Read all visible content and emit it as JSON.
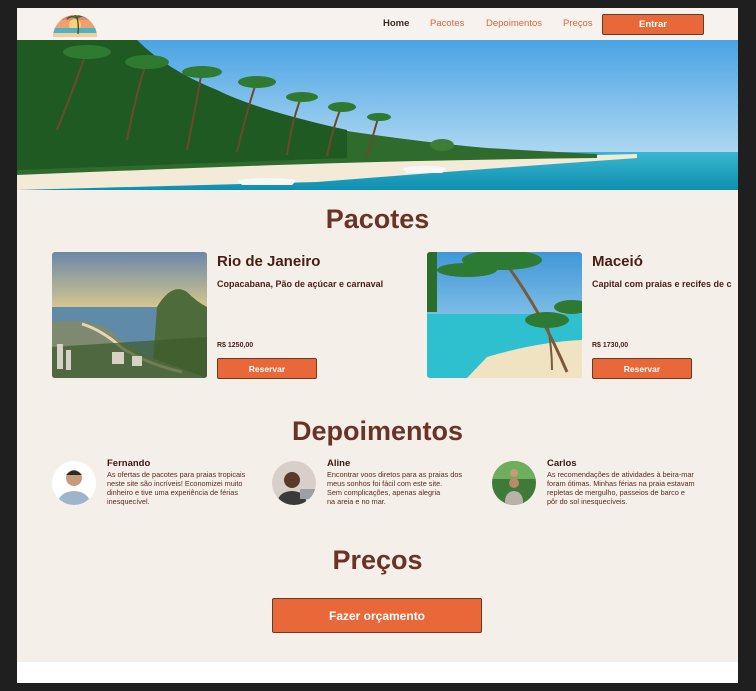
{
  "nav": {
    "links": [
      "Home",
      "Pacotes",
      "Depoimentos",
      "Preços"
    ],
    "login_label": "Entrar"
  },
  "sections": {
    "packages_title": "Pacotes",
    "testimonials_title": "Depoimentos",
    "prices_title": "Preços"
  },
  "packages": [
    {
      "name": "Rio de Janeiro",
      "description": "Copacabana, Pão de açúcar e carnaval",
      "price": "R$ 1250,00",
      "button": "Reservar"
    },
    {
      "name": "Maceió",
      "description": "Capital com praias e recifes de c",
      "price": "R$ 1730,00",
      "button": "Reservar"
    }
  ],
  "testimonials": [
    {
      "name": "Fernando",
      "text": "As ofertas de pacotes para praias tropicais\nneste site são incríveis! Economizei muito\ndinheiro e tive uma experiência de férias\ninesquecível."
    },
    {
      "name": "Aline",
      "text": "Encontrar voos diretos para as praias dos\n meus sonhos foi fácil com este site.\nSem complicações, apenas alegria\nna areia e no mar."
    },
    {
      "name": "Carlos",
      "text": "As recomendações de atividades à beira-mar\nforam ótimas. Minhas férias na praia estavam\nrepletas de mergulho, passeios de barco e\npôr do sol inesquecíveis."
    }
  ],
  "prices": {
    "quote_button": "Fazer orçamento"
  },
  "colors": {
    "accent": "#e8683a",
    "title": "#6b3326",
    "background": "#f5efea"
  }
}
